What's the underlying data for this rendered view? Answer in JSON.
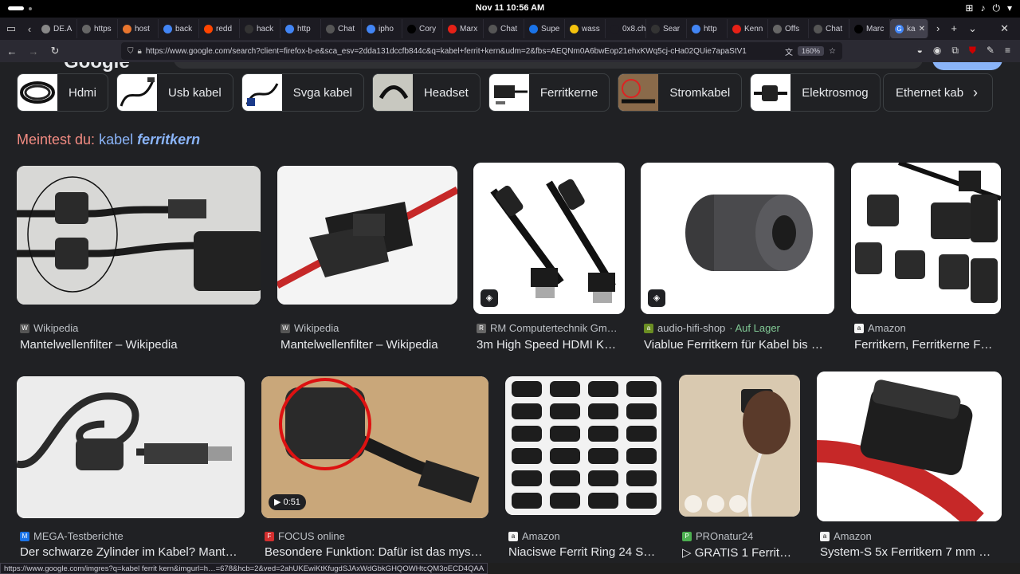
{
  "os": {
    "clock": "Nov 11  10:56 AM"
  },
  "tabs": [
    {
      "label": "DE.A",
      "color": "#888"
    },
    {
      "label": "https",
      "color": "#666"
    },
    {
      "label": "host",
      "color": "#e8752e"
    },
    {
      "label": "back",
      "color": "#4285f4"
    },
    {
      "label": "redd",
      "color": "#ff4500"
    },
    {
      "label": "hack",
      "color": "#333"
    },
    {
      "label": "http",
      "color": "#4285f4"
    },
    {
      "label": "Chat",
      "color": "#555"
    },
    {
      "label": "ipho",
      "color": "#4285f4"
    },
    {
      "label": "Cory",
      "color": "#000"
    },
    {
      "label": "Marx",
      "color": "#e62117"
    },
    {
      "label": "Chat",
      "color": "#555"
    },
    {
      "label": "Supe",
      "color": "#1a73e8"
    },
    {
      "label": "wass",
      "color": "#f4c20d"
    },
    {
      "label": "0x8.ch/",
      "color": "#1c1b22"
    },
    {
      "label": "Sear",
      "color": "#333"
    },
    {
      "label": "http",
      "color": "#4285f4"
    },
    {
      "label": "Kenn",
      "color": "#e62117"
    },
    {
      "label": "Offs",
      "color": "#666"
    },
    {
      "label": "Chat",
      "color": "#555"
    },
    {
      "label": "Marc",
      "color": "#000"
    }
  ],
  "active_tab": {
    "label": "ka",
    "close": "✕"
  },
  "address": {
    "url": "https://www.google.com/search?client=firefox-b-e&sca_esv=2dda131dccfb844c&q=kabel+ferrit+kern&udm=2&fbs=AEQNm0A6bwEop21ehxKWq5cj-cHa02QUie7apaStV1",
    "zoom": "160%"
  },
  "chips": [
    "Hdmi",
    "Usb kabel",
    "Svga kabel",
    "Headset",
    "Ferritkerne",
    "Stromkabel",
    "Elektrosmog"
  ],
  "chip_more": "Ethernet kabel",
  "dym": {
    "prefix": "Meintest du:",
    "query": "kabel",
    "fix": "ferritkern"
  },
  "results_row1": [
    {
      "source": "Wikipedia",
      "title": "Mantelwellenfilter – Wikipedia",
      "fav": "W",
      "favc": "#555"
    },
    {
      "source": "Wikipedia",
      "title": "Mantelwellenfilter – Wikipedia",
      "fav": "W",
      "favc": "#555"
    },
    {
      "source": "RM Computertechnik Gm…",
      "title": "3m High Speed HDMI K…",
      "fav": "R",
      "favc": "#666"
    },
    {
      "source": "audio-hifi-shop",
      "stock": "· Auf Lager",
      "title": "Viablue Ferritkern für Kabel bis …",
      "fav": "a",
      "favc": "#6b8e23"
    },
    {
      "source": "Amazon",
      "title": "Ferritkern, Ferritkerne F…",
      "fav": "a",
      "favc": "#f5f5f5"
    }
  ],
  "results_row2": [
    {
      "source": "MEGA-Testberichte",
      "title": "Der schwarze Zylinder im Kabel? Mant…",
      "fav": "M",
      "favc": "#1a73e8"
    },
    {
      "source": "FOCUS online",
      "title": "Besondere Funktion: Dafür ist das mys…",
      "fav": "F",
      "favc": "#d32f2f",
      "video": "0:51"
    },
    {
      "source": "Amazon",
      "title": "Niaciswe Ferrit Ring 24 S…",
      "fav": "a",
      "favc": "#f5f5f5"
    },
    {
      "source": "PROnatur24",
      "title": "▷ GRATIS 1 Ferrit…",
      "fav": "P",
      "favc": "#4caf50"
    },
    {
      "source": "Amazon",
      "title": "System-S 5x Ferritkern 7 mm …",
      "fav": "a",
      "favc": "#f5f5f5"
    }
  ],
  "status": "https://www.google.com/imgres?q=kabel ferrit kern&imgurl=h…=678&hcb=2&ved=2ahUKEwiKtKfugdSJAxWdGbkGHQOWHtcQM3oECD4QAA"
}
